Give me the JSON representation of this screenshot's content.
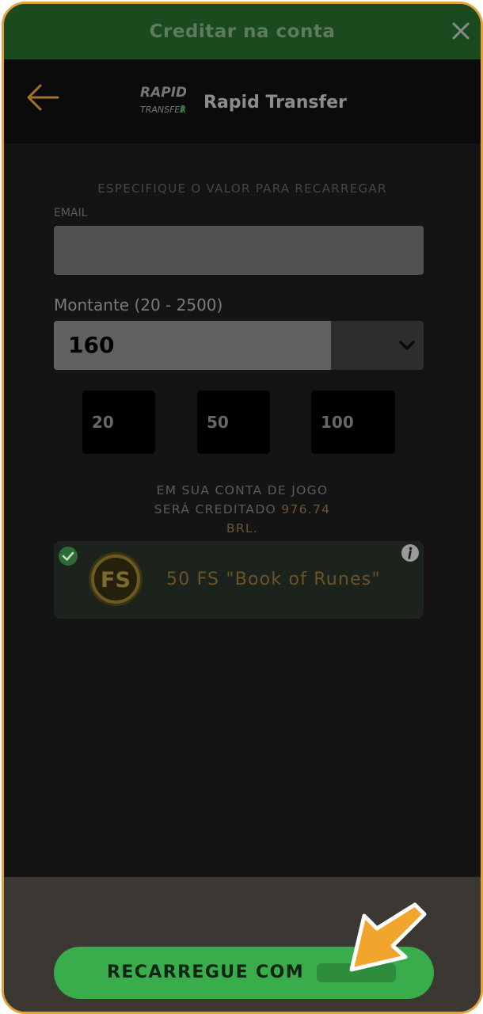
{
  "modal": {
    "title": "Creditar na conta"
  },
  "header": {
    "brand_name": "Rapid Transfer",
    "logo_line1": "RAPID",
    "logo_line2": "TRANSFER"
  },
  "form": {
    "instruction": "ESPECIFIQUE O VALOR PARA RECARREGAR",
    "email_label": "EMAIL",
    "email_value": "",
    "amount_label": "Montante (20 - 2500)",
    "amount_value": "160",
    "presets": [
      "20",
      "50",
      "100"
    ]
  },
  "credit_info": {
    "line1": "EM SUA CONTA DE JOGO",
    "line2_prefix": "SERÁ CREDITADO ",
    "amount": "976.74",
    "currency": "BRL."
  },
  "bonus": {
    "badge": "FS",
    "text": "50 FS \"Book of Runes\""
  },
  "footer": {
    "button_label": "RECARREGUE COM"
  },
  "colors": {
    "accent_orange": "#e1a23a",
    "header_green": "#1a4a1e",
    "button_green": "#39ac4b",
    "background": "#141414"
  }
}
